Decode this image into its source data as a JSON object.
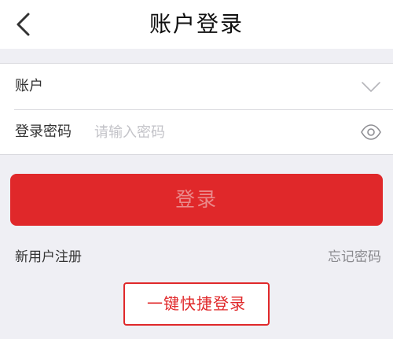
{
  "header": {
    "title": "账户登录",
    "back_icon": "chevron-left-icon"
  },
  "form": {
    "account_label": "账户",
    "account_value": "",
    "account_dropdown_icon": "chevron-down-icon",
    "password_label": "登录密码",
    "password_placeholder": "请输入密码",
    "password_visibility_icon": "eye-icon"
  },
  "actions": {
    "login_label": "登录",
    "register_label": "新用户注册",
    "forgot_label": "忘记密码",
    "quick_login_label": "一键快捷登录"
  },
  "colors": {
    "accent": "#e0282a",
    "background": "#efeff4",
    "surface": "#ffffff"
  }
}
